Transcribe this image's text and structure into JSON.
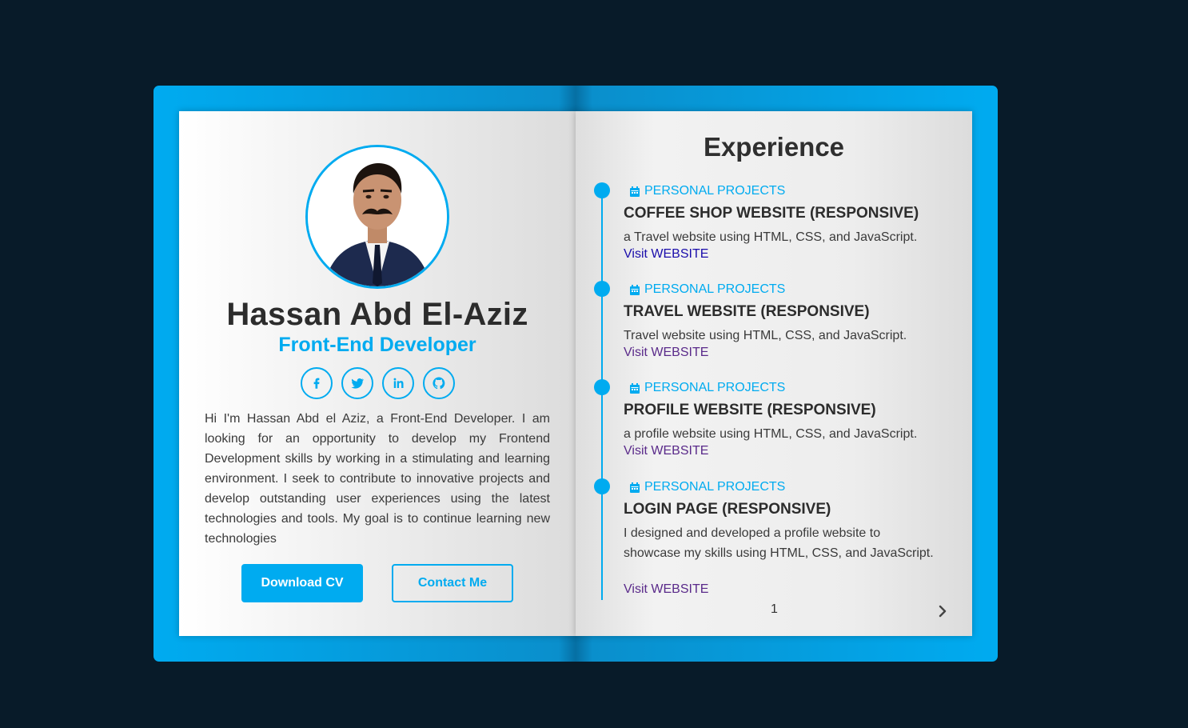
{
  "profile": {
    "name": "Hassan Abd El-Aziz",
    "role": "Front-End Developer",
    "bio": "Hi I'm Hassan Abd el Aziz, a Front-End Developer. I am looking for an opportunity to develop my Frontend Development skills by working in a stimulating and learning environment. I seek to contribute to innovative projects and develop outstanding user experiences using the latest technologies and tools. My goal is to continue learning new technologies",
    "socials": [
      "facebook-icon",
      "twitter-icon",
      "linkedin-icon",
      "github-icon"
    ],
    "download_label": "Download CV",
    "contact_label": "Contact Me"
  },
  "experience": {
    "title": "Experience",
    "items": [
      {
        "category": "PERSONAL PROJECTS",
        "title": "COFFEE SHOP WEBSITE (RESPONSIVE)",
        "description": "a Travel website using HTML, CSS, and JavaScript.",
        "link": "Visit WEBSITE",
        "link_color": "#1a0dab"
      },
      {
        "category": "PERSONAL PROJECTS",
        "title": "TRAVEL WEBSITE (RESPONSIVE)",
        "description": "Travel website using HTML, CSS, and JavaScript.",
        "link": "Visit WEBSITE",
        "link_color": "#5a2a8a"
      },
      {
        "category": "PERSONAL PROJECTS",
        "title": "PROFILE WEBSITE (RESPONSIVE)",
        "description": "a profile website using HTML, CSS, and JavaScript.",
        "link": "Visit WEBSITE",
        "link_color": "#5a2a8a"
      },
      {
        "category": "PERSONAL PROJECTS",
        "title": "LOGIN PAGE (RESPONSIVE)",
        "description": "I designed and developed a profile website to showcase my skills using HTML, CSS, and JavaScript.",
        "link": "Visit WEBSITE",
        "link_color": "#5a2a8a"
      }
    ],
    "page_number": "1"
  },
  "colors": {
    "accent": "#00abf0",
    "background": "#081b29"
  }
}
